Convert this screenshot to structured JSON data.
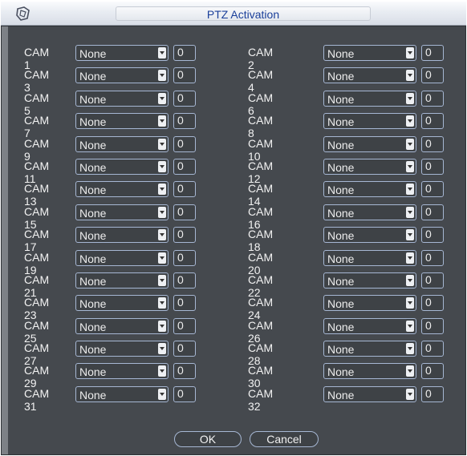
{
  "window": {
    "title": "PTZ Activation"
  },
  "cams": [
    {
      "label": "CAM 1",
      "type": "None",
      "value": "0"
    },
    {
      "label": "CAM 2",
      "type": "None",
      "value": "0"
    },
    {
      "label": "CAM 3",
      "type": "None",
      "value": "0"
    },
    {
      "label": "CAM 4",
      "type": "None",
      "value": "0"
    },
    {
      "label": "CAM 5",
      "type": "None",
      "value": "0"
    },
    {
      "label": "CAM 6",
      "type": "None",
      "value": "0"
    },
    {
      "label": "CAM 7",
      "type": "None",
      "value": "0"
    },
    {
      "label": "CAM 8",
      "type": "None",
      "value": "0"
    },
    {
      "label": "CAM 9",
      "type": "None",
      "value": "0"
    },
    {
      "label": "CAM 10",
      "type": "None",
      "value": "0"
    },
    {
      "label": "CAM 11",
      "type": "None",
      "value": "0"
    },
    {
      "label": "CAM 12",
      "type": "None",
      "value": "0"
    },
    {
      "label": "CAM 13",
      "type": "None",
      "value": "0"
    },
    {
      "label": "CAM 14",
      "type": "None",
      "value": "0"
    },
    {
      "label": "CAM 15",
      "type": "None",
      "value": "0"
    },
    {
      "label": "CAM 16",
      "type": "None",
      "value": "0"
    },
    {
      "label": "CAM 17",
      "type": "None",
      "value": "0"
    },
    {
      "label": "CAM 18",
      "type": "None",
      "value": "0"
    },
    {
      "label": "CAM 19",
      "type": "None",
      "value": "0"
    },
    {
      "label": "CAM 20",
      "type": "None",
      "value": "0"
    },
    {
      "label": "CAM 21",
      "type": "None",
      "value": "0"
    },
    {
      "label": "CAM 22",
      "type": "None",
      "value": "0"
    },
    {
      "label": "CAM 23",
      "type": "None",
      "value": "0"
    },
    {
      "label": "CAM 24",
      "type": "None",
      "value": "0"
    },
    {
      "label": "CAM 25",
      "type": "None",
      "value": "0"
    },
    {
      "label": "CAM 26",
      "type": "None",
      "value": "0"
    },
    {
      "label": "CAM 27",
      "type": "None",
      "value": "0"
    },
    {
      "label": "CAM 28",
      "type": "None",
      "value": "0"
    },
    {
      "label": "CAM 29",
      "type": "None",
      "value": "0"
    },
    {
      "label": "CAM 30",
      "type": "None",
      "value": "0"
    },
    {
      "label": "CAM 31",
      "type": "None",
      "value": "0"
    },
    {
      "label": "CAM 32",
      "type": "None",
      "value": "0"
    }
  ],
  "buttons": {
    "ok": "OK",
    "cancel": "Cancel"
  },
  "colors": {
    "title_text": "#1a3f9a",
    "panel_bg": "#45494e",
    "control_border": "#a6b7d3"
  },
  "icons": {
    "logo": "app-logo-icon",
    "dropdown": "chevron-down-icon"
  }
}
